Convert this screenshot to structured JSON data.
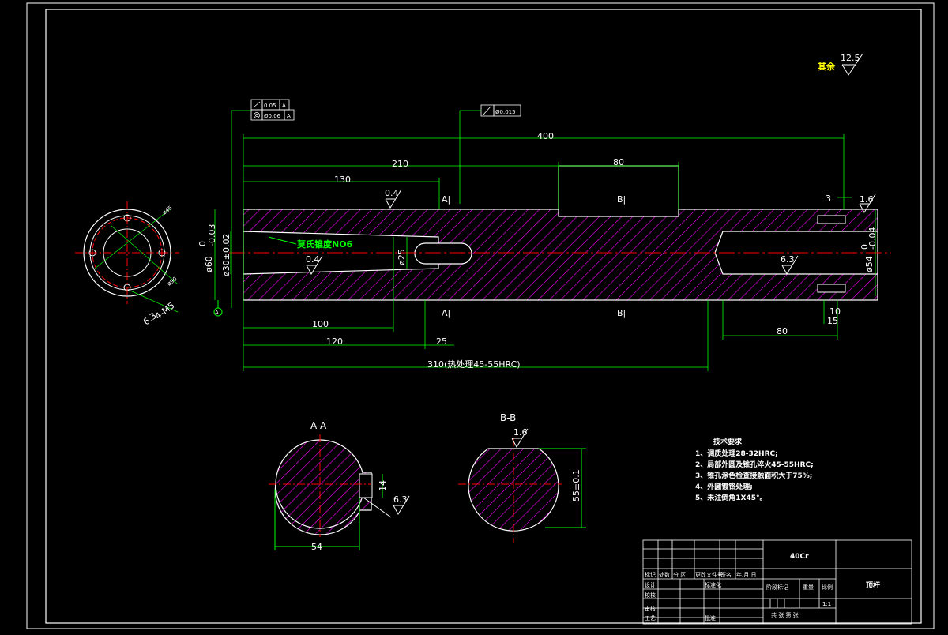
{
  "drawing": {
    "title_part_name": "顶杆",
    "material": "40Cr",
    "scale": "1:1",
    "roughness_note_label": "其余",
    "roughness_note_value": "12.5",
    "section_aa": "A-A",
    "section_bb": "B-B",
    "gdt_perp_value": "0.05",
    "gdt_perp_datum": "A",
    "gdt_coax_value": "Ø0.06",
    "gdt_coax_datum": "A",
    "gdt_runout_value": "Ø0.015",
    "datum_letter": "A",
    "morse_label": "莫氏锥度NO6",
    "heat_treat_label": "310(热处理45-55HRC)",
    "section_marker_a": "A|",
    "section_marker_b": "B|"
  },
  "dimensions": {
    "d400": "400",
    "d210": "210",
    "d80_top": "80",
    "d130": "130",
    "d100": "100",
    "d120": "120",
    "d25": "25",
    "d80_bot": "80",
    "d3": "3",
    "d10": "10",
    "d15": "15",
    "d_dia60": "ø60",
    "d_dia60_tol": "-0.03",
    "d_dia30": "ø30±0.02",
    "d_dia25": "ø25",
    "d_dia54": "ø54",
    "d_dia54_tol": "-0.04",
    "d_tol_zero": "0",
    "r04_a": "0.4",
    "r04_b": "0.4",
    "r16_a": "1.6",
    "r16_b": "1.6",
    "r63_a": "6.3",
    "r63_b": "6.3",
    "r63_c": "6.3",
    "d54_sec": "54",
    "d14_sec": "14",
    "d55_sec": "55±0.1",
    "end_dia45": "ø45",
    "end_dia90": "ø90",
    "end_holes": "4-M5"
  },
  "tech_requirements": {
    "heading": "技术要求",
    "items": [
      "1、调质处理28-32HRC;",
      "2、局部外圆及锥孔淬火45-55HRC;",
      "3、锥孔涂色检查接触面积大于75%;",
      "4、外圆镀铬处理;",
      "5、未注倒角1X45°。"
    ]
  },
  "title_block": {
    "row_labels": [
      "标记",
      "处数",
      "分 区",
      "更改文件号",
      "签名",
      "年.月.日"
    ],
    "left_labels": [
      "设计",
      "校核",
      "审核",
      "工艺"
    ],
    "mid_labels": [
      "标准化",
      "批准"
    ],
    "stage_label": "阶段标记",
    "weight_label": "重量",
    "scale_label": "比例",
    "sheet_label": "共 张 第 张"
  }
}
